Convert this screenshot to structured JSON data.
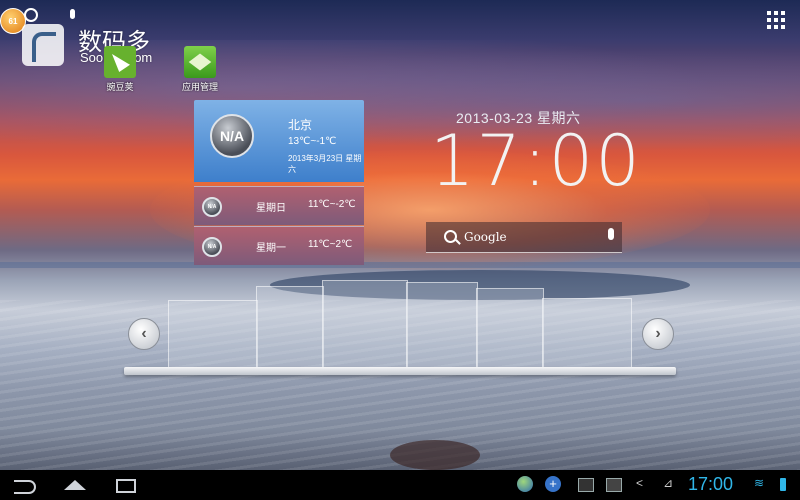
{
  "top": {
    "badge": "61",
    "watermark_cn": "数码多",
    "watermark_en": "Soomal.com"
  },
  "apps": [
    {
      "label": "豌豆荚",
      "icon": "wandoujia-icon"
    },
    {
      "label": "应用管理",
      "icon": "app-manager-icon"
    }
  ],
  "weather": {
    "na": "N/A",
    "city": "北京",
    "temp": "13℃~-1℃",
    "date": "2013年3月23日 星期六",
    "forecast": [
      {
        "na": "N/A",
        "day": "星期日",
        "temp": "11℃~-2℃"
      },
      {
        "na": "N/A",
        "day": "星期一",
        "temp": "11℃~2℃"
      }
    ]
  },
  "clock": {
    "date": "2013-03-23  星期六",
    "time": "17:00"
  },
  "google_search": {
    "label": "Google"
  },
  "carousel": {
    "prev": "‹",
    "next": "›"
  },
  "status_bar": {
    "time": "17:00",
    "plus": "+",
    "share": "<",
    "nosig": "⊿",
    "wifi": "≋"
  },
  "colors": {
    "status_accent": "#30b6e8",
    "weather_top": "#3e7fcb"
  }
}
